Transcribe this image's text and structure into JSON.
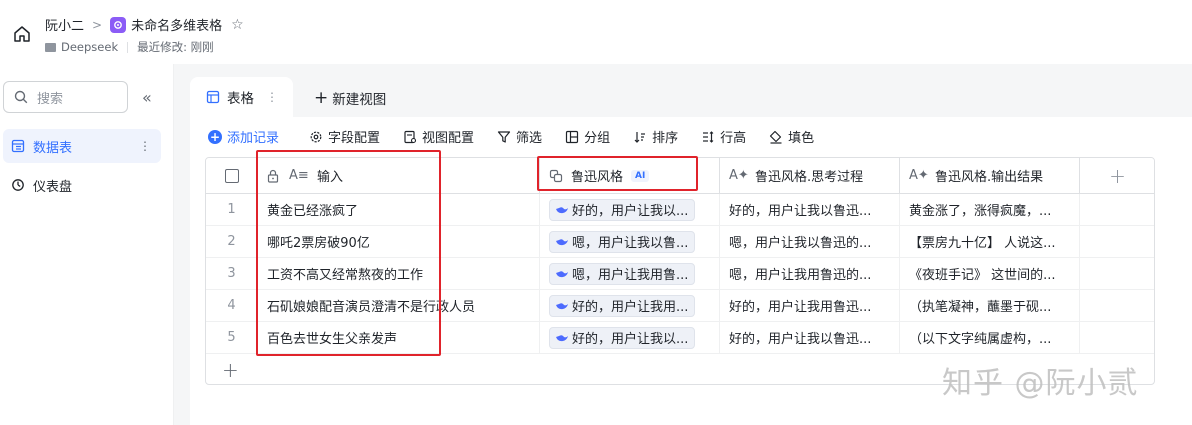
{
  "header": {
    "breadcrumb_owner": "阮小二",
    "breadcrumb_sep": ">",
    "doc_title": "未命名多维表格",
    "space_name": "Deepseek",
    "last_modified": "最近修改: 刚刚"
  },
  "sidebar": {
    "search_placeholder": "搜索",
    "collapse_icon": "«",
    "items": [
      {
        "label": "数据表",
        "icon": "table-icon",
        "active": true
      },
      {
        "label": "仪表盘",
        "icon": "dashboard-icon",
        "active": false
      }
    ]
  },
  "tabs": {
    "current_tab": "表格",
    "new_view_label": "新建视图"
  },
  "toolbar": {
    "add_record": "添加记录",
    "field_config": "字段配置",
    "view_config": "视图配置",
    "filter": "筛选",
    "group": "分组",
    "sort": "排序",
    "row_height": "行高",
    "fill_color": "填色"
  },
  "table": {
    "columns": [
      {
        "name": "输入",
        "type": "text"
      },
      {
        "name": "鲁迅风格",
        "badge": "AI"
      },
      {
        "name": "鲁迅风格.思考过程"
      },
      {
        "name": "鲁迅风格.输出结果"
      }
    ],
    "rows": [
      {
        "num": "1",
        "input": "黄金已经涨疯了",
        "style": "好的，用户让我以...",
        "thinking": "好的，用户让我以鲁迅...",
        "output": "黄金涨了，涨得疯魔，..."
      },
      {
        "num": "2",
        "input": "哪吒2票房破90亿",
        "style": "嗯，用户让我以鲁...",
        "thinking": "嗯，用户让我以鲁迅的...",
        "output": "【票房九十亿】 人说这..."
      },
      {
        "num": "3",
        "input": "工资不高又经常熬夜的工作",
        "style": "嗯，用户让我用鲁...",
        "thinking": "嗯，用户让我用鲁迅的...",
        "output": "《夜班手记》 这世间的..."
      },
      {
        "num": "4",
        "input": "石矶娘娘配音演员澄清不是行政人员",
        "style": "好的，用户让我用...",
        "thinking": "好的，用户让我用鲁迅...",
        "output": "（执笔凝神，蘸墨于砚..."
      },
      {
        "num": "5",
        "input": "百色去世女生父亲发声",
        "style": "好的，用户让我以...",
        "thinking": "好的，用户让我以鲁迅...",
        "output": "（以下文字纯属虚构，..."
      }
    ]
  },
  "watermark": "知乎 @阮小贰",
  "colors": {
    "accent": "#3370ff",
    "highlight_box": "#e0232b",
    "doc_icon": "#8b5cf6"
  }
}
